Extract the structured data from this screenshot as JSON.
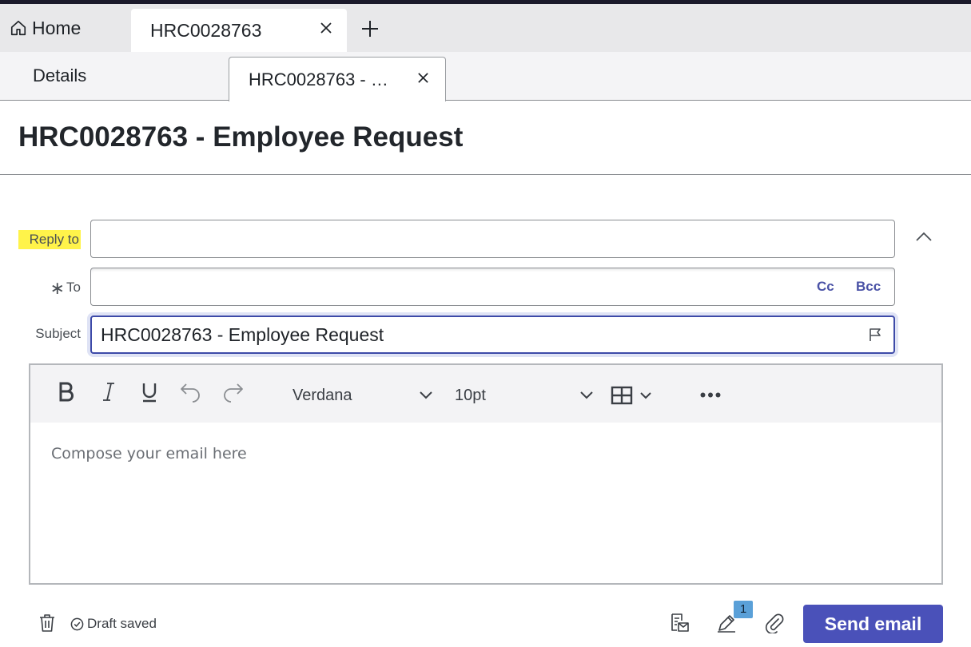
{
  "tabs_top": {
    "home_label": "Home",
    "active_label": "HRC0028763"
  },
  "tabs_sub": {
    "details_label": "Details",
    "active_label": "HRC0028763 - …"
  },
  "page": {
    "title": "HRC0028763 - Employee Request"
  },
  "form": {
    "reply_to_label": "Reply to",
    "reply_to_value": "",
    "to_required_mark": "∗",
    "to_label": "To",
    "to_value": "",
    "cc_label": "Cc",
    "bcc_label": "Bcc",
    "subject_label": "Subject",
    "subject_value": "HRC0028763 - Employee Request"
  },
  "editor": {
    "font_family": "Verdana",
    "font_size": "10pt",
    "placeholder": "Compose your email here"
  },
  "footer": {
    "draft_status": "Draft saved",
    "signature_badge_count": "1",
    "send_label": "Send email"
  },
  "colors": {
    "accent": "#4a51b9",
    "highlight": "#fff34a",
    "badge": "#5aa0d8"
  }
}
